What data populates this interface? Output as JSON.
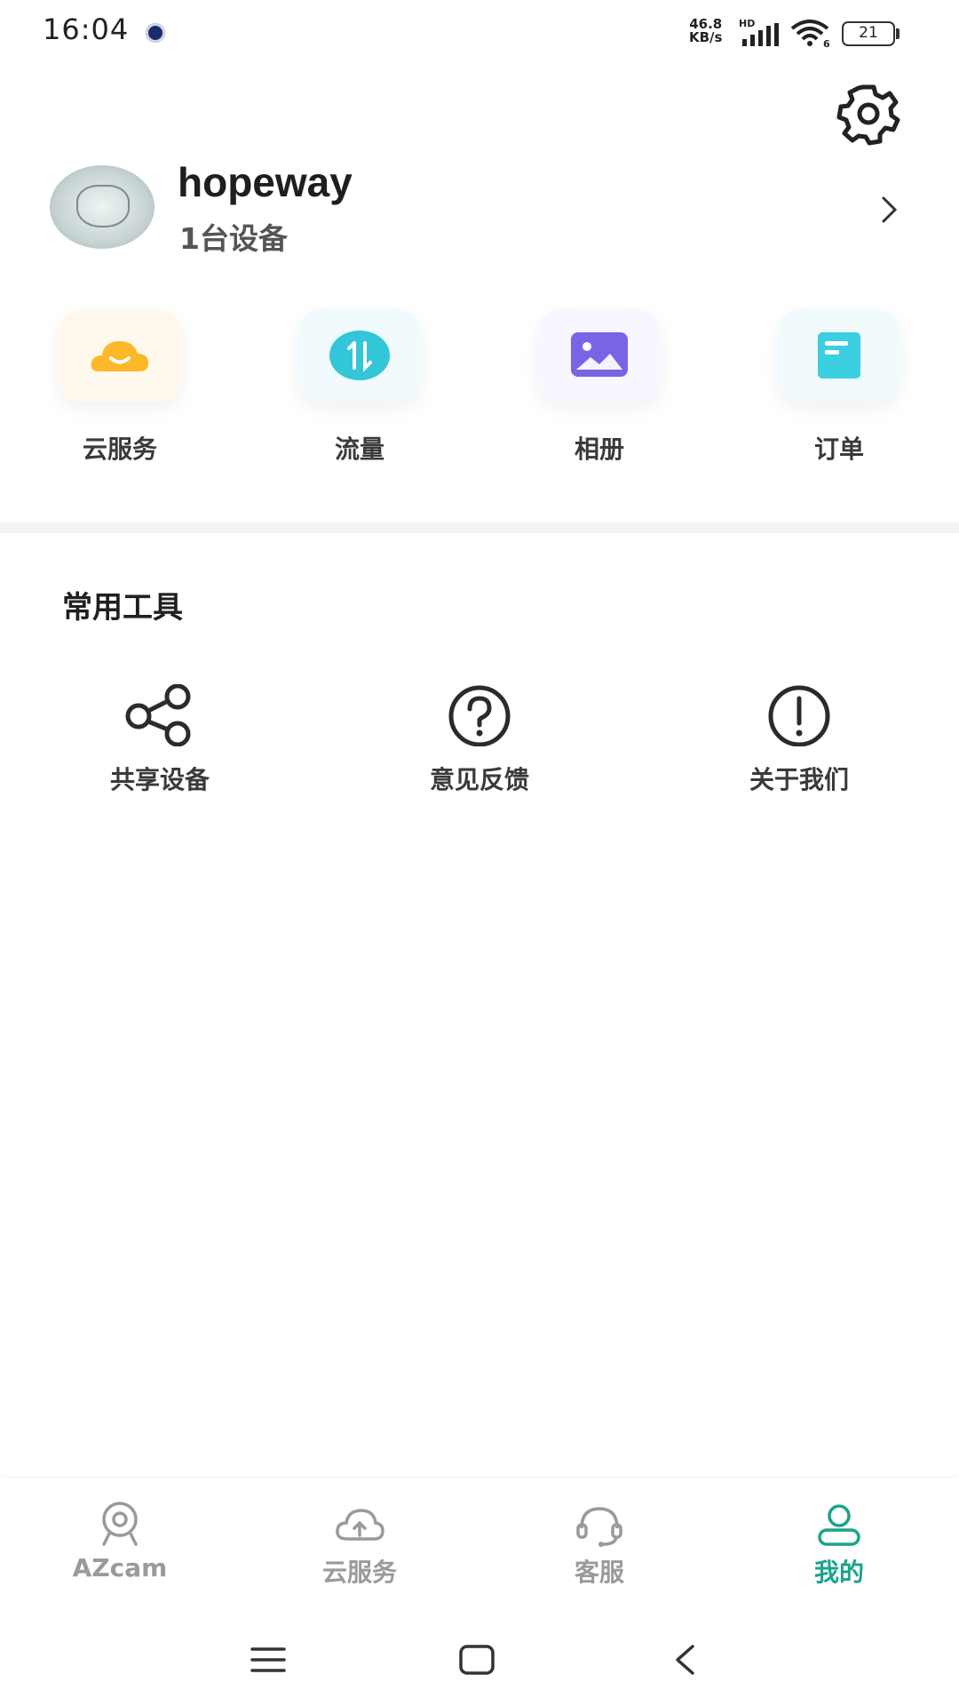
{
  "status_bar": {
    "time": "16:04",
    "net_speed_value": "46.8",
    "net_speed_unit": "KB/s",
    "hd": "HD",
    "wifi_generation": "6",
    "battery": "21"
  },
  "profile": {
    "username": "hopeway",
    "device_count": "1台设备"
  },
  "shortcuts": [
    {
      "label": "云服务",
      "icon": "cloud-smile-icon",
      "color": "#fbb829"
    },
    {
      "label": "流量",
      "icon": "data-transfer-icon",
      "color": "#33c6d8"
    },
    {
      "label": "相册",
      "icon": "album-icon",
      "color": "#7b63e6"
    },
    {
      "label": "订单",
      "icon": "order-icon",
      "color": "#3bcfe0"
    }
  ],
  "tools_section": {
    "title": "常用工具",
    "items": [
      {
        "label": "共享设备",
        "icon": "share-icon"
      },
      {
        "label": "意见反馈",
        "icon": "question-icon"
      },
      {
        "label": "关于我们",
        "icon": "info-exclamation-icon"
      }
    ]
  },
  "bottom_nav": {
    "active_color": "#1aa38c",
    "items": [
      {
        "label": "AZcam",
        "icon": "camera-icon",
        "active": false
      },
      {
        "label": "云服务",
        "icon": "cloud-upload-icon",
        "active": false
      },
      {
        "label": "客服",
        "icon": "headset-icon",
        "active": false
      },
      {
        "label": "我的",
        "icon": "user-icon",
        "active": true
      }
    ]
  }
}
